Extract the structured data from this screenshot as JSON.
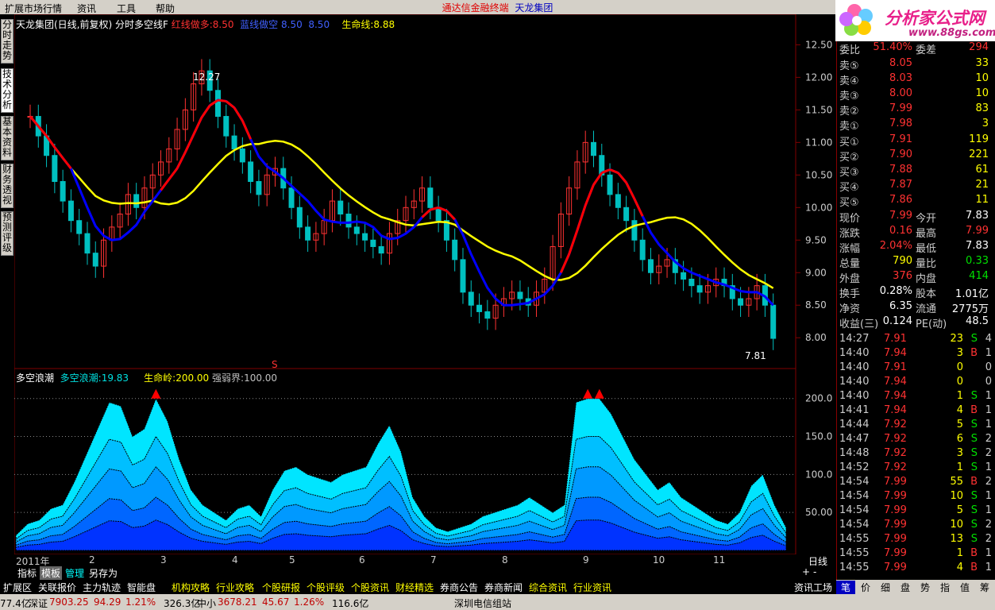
{
  "menu": {
    "items": [
      "扩展市场行情",
      "资讯",
      "工具",
      "帮助"
    ],
    "title_left": "通达信金融终端",
    "title_right": "天龙集团"
  },
  "logo": {
    "line1": "分析家公式网",
    "line2": "www.88gs.com"
  },
  "sidetabs": [
    "分时走势",
    "技术分析",
    "基本资料",
    "财务透视",
    "预测评级"
  ],
  "main_legend": {
    "name": "天龙集团(日线,前复权)",
    "indicator": "分时多空线F",
    "red_label": "红线做多:",
    "red_val": "8.50",
    "blue_label": "蓝线做空",
    "blue_val": "8.50",
    "val3": "8.50",
    "life_label": "生命线:",
    "life_val": "8.88"
  },
  "sub_legend": {
    "name": "多空浪潮",
    "wave_label": "多空浪潮:",
    "wave_val": "19.83",
    "peak_label": "生命岭:",
    "peak_val": "200.00",
    "strong_label": "强弱界:",
    "strong_val": "100.00"
  },
  "price_axis": [
    "12.50",
    "12.00",
    "11.50",
    "11.00",
    "10.50",
    "10.00",
    "9.50",
    "9.00",
    "8.50",
    "8.00"
  ],
  "sub_axis": [
    "200.0",
    "150.0",
    "100.0",
    "50.00"
  ],
  "annotations": {
    "high": "12.27",
    "low": "7.81",
    "s_mark": "S"
  },
  "time_axis": {
    "labels": [
      "2011年",
      "2",
      "3",
      "4",
      "5",
      "6",
      "7",
      "8",
      "9",
      "10",
      "11"
    ],
    "right": "日线"
  },
  "subtabs": [
    "指标",
    "模板",
    "管理",
    "另存为"
  ],
  "bottom_items": [
    "扩展区",
    "关联报价",
    "主力轨迹",
    "智能盘",
    "机构攻略",
    "行业攻略",
    "个股研报",
    "个股评级",
    "个股资讯",
    "财经精选",
    "券商公告",
    "券商新闻",
    "综合资讯",
    "行业资讯",
    "资讯工场"
  ],
  "panel": {
    "ratio": {
      "l1": "委比",
      "v1": "51.40%",
      "l2": "委差",
      "v2": "294"
    },
    "sells": [
      {
        "label": "卖⑤",
        "price": "8.05",
        "vol": "33"
      },
      {
        "label": "卖④",
        "price": "8.03",
        "vol": "10"
      },
      {
        "label": "卖③",
        "price": "8.00",
        "vol": "10"
      },
      {
        "label": "卖②",
        "price": "7.99",
        "vol": "83"
      },
      {
        "label": "卖①",
        "price": "7.98",
        "vol": "3"
      }
    ],
    "buys": [
      {
        "label": "买①",
        "price": "7.91",
        "vol": "119"
      },
      {
        "label": "买②",
        "price": "7.90",
        "vol": "221"
      },
      {
        "label": "买③",
        "price": "7.88",
        "vol": "61"
      },
      {
        "label": "买④",
        "price": "7.87",
        "vol": "21"
      },
      {
        "label": "买⑤",
        "price": "7.86",
        "vol": "11"
      }
    ],
    "stats": [
      {
        "l1": "现价",
        "v1": "7.99",
        "c1": "red",
        "l2": "今开",
        "v2": "7.83",
        "c2": "wht"
      },
      {
        "l1": "涨跌",
        "v1": "0.16",
        "c1": "red",
        "l2": "最高",
        "v2": "7.99",
        "c2": "red"
      },
      {
        "l1": "涨幅",
        "v1": "2.04%",
        "c1": "red",
        "l2": "最低",
        "v2": "7.83",
        "c2": "wht"
      },
      {
        "l1": "总量",
        "v1": "790",
        "c1": "yel",
        "l2": "量比",
        "v2": "0.33",
        "c2": "grn"
      },
      {
        "l1": "外盘",
        "v1": "376",
        "c1": "red",
        "l2": "内盘",
        "v2": "414",
        "c2": "grn"
      },
      {
        "l1": "换手",
        "v1": "0.28%",
        "c1": "wht",
        "l2": "股本",
        "v2": "1.01亿",
        "c2": "wht"
      },
      {
        "l1": "净资",
        "v1": "6.35",
        "c1": "wht",
        "l2": "流通",
        "v2": "2775万",
        "c2": "wht"
      },
      {
        "l1": "收益(三)",
        "v1": "0.124",
        "c1": "wht",
        "l2": "PE(动)",
        "v2": "48.5",
        "c2": "wht"
      }
    ],
    "ticks": [
      {
        "t": "14:27",
        "p": "7.91",
        "v": "23",
        "bs": "S",
        "c": "4"
      },
      {
        "t": "14:40",
        "p": "7.94",
        "v": "3",
        "bs": "B",
        "c": "1"
      },
      {
        "t": "14:40",
        "p": "7.91",
        "v": "0",
        "bs": "",
        "c": "0"
      },
      {
        "t": "14:40",
        "p": "7.94",
        "v": "0",
        "bs": "",
        "c": "0"
      },
      {
        "t": "14:40",
        "p": "7.94",
        "v": "1",
        "bs": "S",
        "c": "1"
      },
      {
        "t": "14:41",
        "p": "7.94",
        "v": "4",
        "bs": "B",
        "c": "1"
      },
      {
        "t": "14:44",
        "p": "7.92",
        "v": "5",
        "bs": "S",
        "c": "1"
      },
      {
        "t": "14:47",
        "p": "7.92",
        "v": "6",
        "bs": "S",
        "c": "2"
      },
      {
        "t": "14:48",
        "p": "7.92",
        "v": "3",
        "bs": "S",
        "c": "2"
      },
      {
        "t": "14:52",
        "p": "7.92",
        "v": "1",
        "bs": "S",
        "c": "1"
      },
      {
        "t": "14:54",
        "p": "7.99",
        "v": "55",
        "bs": "B",
        "c": "2"
      },
      {
        "t": "14:54",
        "p": "7.99",
        "v": "10",
        "bs": "S",
        "c": "1"
      },
      {
        "t": "14:54",
        "p": "7.99",
        "v": "5",
        "bs": "S",
        "c": "1"
      },
      {
        "t": "14:54",
        "p": "7.99",
        "v": "10",
        "bs": "S",
        "c": "2"
      },
      {
        "t": "14:55",
        "p": "7.99",
        "v": "13",
        "bs": "S",
        "c": "2"
      },
      {
        "t": "14:55",
        "p": "7.99",
        "v": "1",
        "bs": "B",
        "c": "1"
      },
      {
        "t": "14:55",
        "p": "7.99",
        "v": "4",
        "bs": "B",
        "c": "1"
      }
    ],
    "tabs": [
      "笔",
      "价",
      "细",
      "盘",
      "势",
      "指",
      "值",
      "筹"
    ]
  },
  "status": {
    "s0": "77.4亿",
    "s1": "深证",
    "s2": "7903.25",
    "s3": "94.29",
    "s4": "1.21%",
    "s5": "326.3亿",
    "s6": "中小",
    "s7": "3678.21",
    "s8": "45.67",
    "s9": "1.26%",
    "s10": "116.6亿",
    "s11": "深圳电信组站"
  },
  "colors": {
    "up": "#ff3232",
    "down": "#00c0c0",
    "life": "#ffff00",
    "bull": "#ff0000",
    "bear": "#0000ff",
    "wave": "#00e5ff"
  },
  "chart_data": {
    "type": "candlestick",
    "price_range": [
      7.6,
      12.7
    ],
    "close_series": [
      11.4,
      11.1,
      10.8,
      10.4,
      10.1,
      9.8,
      9.6,
      9.3,
      9.1,
      9.5,
      9.7,
      9.9,
      10.2,
      10.0,
      10.3,
      10.5,
      10.7,
      10.9,
      11.2,
      11.5,
      11.9,
      12.1,
      11.8,
      11.4,
      11.1,
      10.9,
      10.7,
      10.4,
      10.2,
      10.5,
      10.6,
      10.3,
      10.0,
      9.7,
      9.5,
      9.6,
      9.8,
      10.1,
      9.9,
      9.7,
      9.6,
      9.5,
      9.4,
      9.3,
      9.6,
      9.8,
      10.0,
      10.1,
      10.3,
      10.0,
      9.8,
      9.5,
      9.2,
      8.7,
      8.5,
      8.4,
      8.3,
      8.5,
      8.6,
      8.7,
      8.6,
      8.5,
      8.7,
      8.9,
      9.4,
      9.9,
      10.3,
      10.7,
      11.0,
      10.8,
      10.5,
      10.2,
      10.0,
      9.8,
      9.5,
      9.2,
      9.0,
      9.1,
      9.2,
      9.0,
      8.9,
      8.8,
      8.7,
      8.8,
      8.9,
      8.8,
      8.6,
      8.5,
      8.6,
      8.8,
      8.5,
      7.99
    ],
    "wave_values": [
      20,
      35,
      40,
      55,
      60,
      90,
      125,
      160,
      195,
      190,
      150,
      160,
      200,
      170,
      120,
      80,
      60,
      50,
      40,
      55,
      60,
      45,
      80,
      105,
      110,
      100,
      95,
      90,
      100,
      105,
      110,
      140,
      165,
      130,
      70,
      45,
      30,
      25,
      30,
      35,
      45,
      50,
      55,
      60,
      70,
      60,
      50,
      60,
      195,
      200,
      200,
      180,
      150,
      120,
      100,
      80,
      90,
      70,
      60,
      50,
      40,
      35,
      50,
      85,
      100,
      60,
      30
    ],
    "life_peak": 200,
    "strong_weak": 100,
    "sub_range": [
      0,
      230
    ]
  }
}
